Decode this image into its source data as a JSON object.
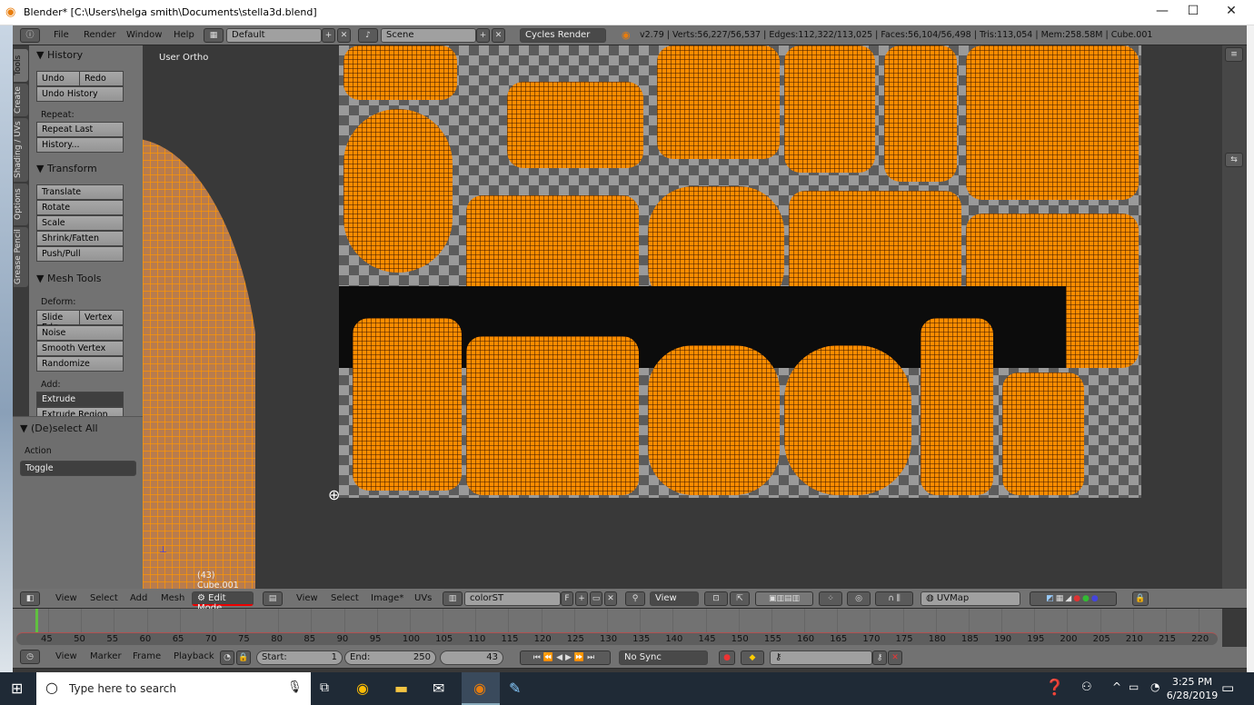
{
  "window": {
    "title": "Blender* [C:\\Users\\helga smith\\Documents\\stella3d.blend]"
  },
  "info_header": {
    "menus": [
      "File",
      "Render",
      "Window",
      "Help"
    ],
    "layout": "Default",
    "scene": "Scene",
    "engine": "Cycles Render",
    "stats": "v2.79 | Verts:56,227/56,537 | Edges:112,322/113,025 | Faces:56,104/56,498 | Tris:113,054 | Mem:258.58M | Cube.001"
  },
  "tool_tabs": [
    "Tools",
    "Create",
    "Shading / UVs",
    "Options",
    "Grease Pencil"
  ],
  "shelf": {
    "history_title": "History",
    "undo": "Undo",
    "redo": "Redo",
    "undo_history": "Undo History",
    "repeat_label": "Repeat:",
    "repeat_last": "Repeat Last",
    "history_btn": "History...",
    "transform_title": "Transform",
    "transform": [
      "Translate",
      "Rotate",
      "Scale",
      "Shrink/Fatten",
      "Push/Pull"
    ],
    "mesh_tools_title": "Mesh Tools",
    "deform_label": "Deform:",
    "slide_edge": "Slide Edg",
    "vertex": "Vertex",
    "deform": [
      "Noise",
      "Smooth Vertex",
      "Randomize"
    ],
    "add_label": "Add:",
    "extrude": "Extrude",
    "extrude_region": "Extrude Region"
  },
  "operator": {
    "title": "(De)select All",
    "action_label": "Action",
    "action_value": "Toggle"
  },
  "viewport": {
    "view_label": "User Ortho",
    "object_label": "(43) Cube.001",
    "header_menus": [
      "View",
      "Select",
      "Add",
      "Mesh"
    ],
    "mode": "Edit Mode"
  },
  "uv_editor": {
    "header_menus": [
      "View",
      "Select",
      "Image*",
      "UVs"
    ],
    "image": "colorST",
    "image_flag": "F",
    "view": "View",
    "uv_map": "UVMap"
  },
  "timeline": {
    "ticks": [
      45,
      50,
      55,
      60,
      65,
      70,
      75,
      80,
      85,
      90,
      95,
      100,
      105,
      110,
      115,
      120,
      125,
      130,
      135,
      140,
      145,
      150,
      155,
      160,
      165,
      170,
      175,
      180,
      185,
      190,
      195,
      200,
      205,
      210,
      215,
      220
    ],
    "current_frame": 43,
    "start_label": "Start:",
    "start": "1",
    "end_label": "End:",
    "end": "250",
    "frame": "43",
    "sync": "No Sync",
    "header_menus": [
      "View",
      "Marker",
      "Frame",
      "Playback"
    ]
  },
  "taskbar": {
    "search_placeholder": "Type here to search",
    "time": "3:25 PM",
    "date": "6/28/2019"
  },
  "colors": {
    "accent": "#ff8c00",
    "panel": "#727272",
    "viewport": "#393939",
    "current_frame": "#60c040"
  }
}
